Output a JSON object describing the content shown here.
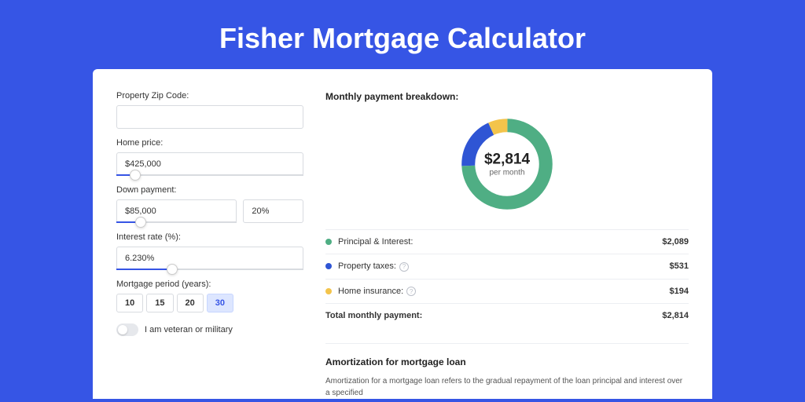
{
  "page_title": "Fisher Mortgage Calculator",
  "form": {
    "zip_label": "Property Zip Code:",
    "zip_value": "",
    "home_price_label": "Home price:",
    "home_price_value": "$425,000",
    "home_price_slider_pct": 10,
    "down_label": "Down payment:",
    "down_value": "$85,000",
    "down_pct_value": "20%",
    "down_slider_pct": 20,
    "rate_label": "Interest rate (%):",
    "rate_value": "6.230%",
    "rate_slider_pct": 30,
    "period_label": "Mortgage period (years):",
    "periods": [
      "10",
      "15",
      "20",
      "30"
    ],
    "period_selected": "30",
    "veteran_label": "I am veteran or military",
    "veteran_on": false
  },
  "breakdown": {
    "title": "Monthly payment breakdown:",
    "center_amount": "$2,814",
    "center_sub": "per month",
    "items": [
      {
        "label": "Principal & Interest:",
        "value": "$2,089",
        "color": "#4FAE84",
        "has_help": false
      },
      {
        "label": "Property taxes:",
        "value": "$531",
        "color": "#2F55D4",
        "has_help": true
      },
      {
        "label": "Home insurance:",
        "value": "$194",
        "color": "#F3C44B",
        "has_help": true
      }
    ],
    "total_label": "Total monthly payment:",
    "total_value": "$2,814"
  },
  "chart_data": {
    "type": "pie",
    "title": "Monthly payment breakdown",
    "series": [
      {
        "name": "Principal & Interest",
        "value": 2089,
        "color": "#4FAE84"
      },
      {
        "name": "Property taxes",
        "value": 531,
        "color": "#2F55D4"
      },
      {
        "name": "Home insurance",
        "value": 194,
        "color": "#F3C44B"
      }
    ],
    "total": 2814,
    "center_label": "$2,814 per month"
  },
  "amort": {
    "title": "Amortization for mortgage loan",
    "text": "Amortization for a mortgage loan refers to the gradual repayment of the loan principal and interest over a specified"
  }
}
